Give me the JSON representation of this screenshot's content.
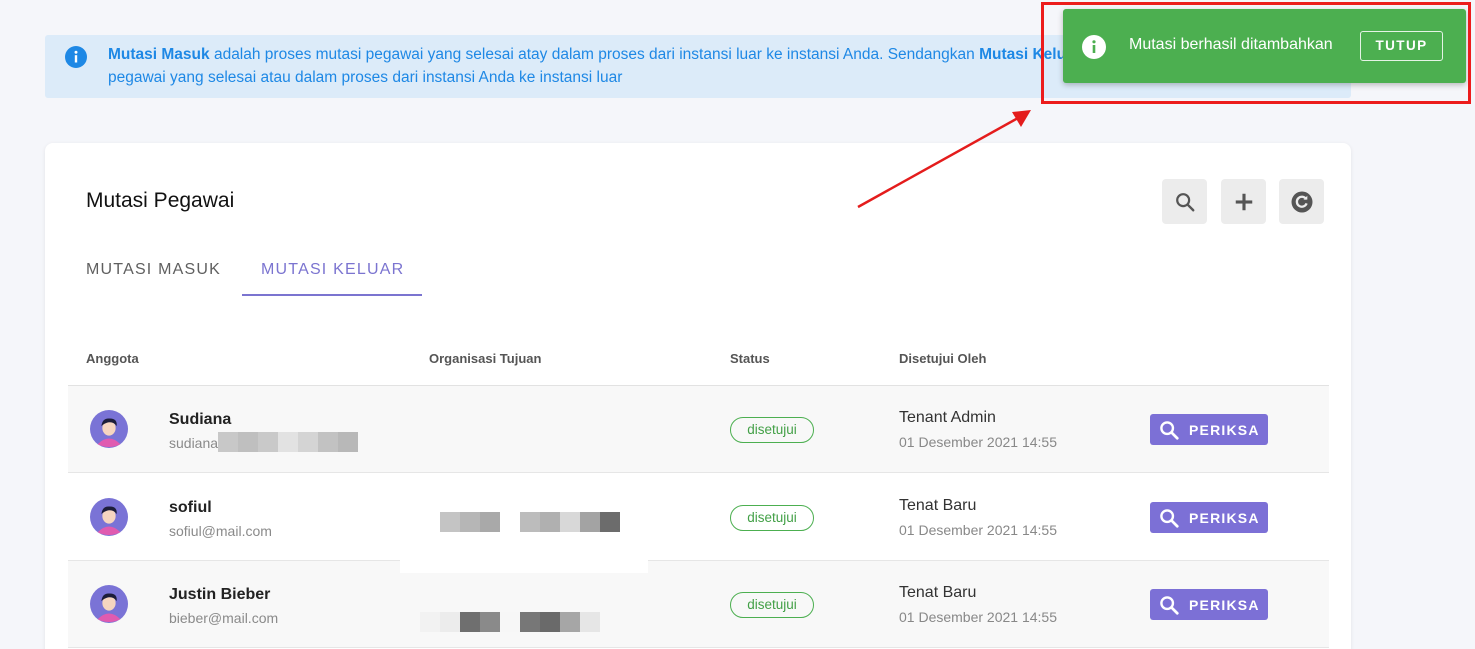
{
  "banner": {
    "term_in": "Mutasi Masuk",
    "text_in": " adalah proses mutasi pegawai yang selesai atay dalam proses dari instansi luar ke instansi Anda. Sendangkan ",
    "term_out": "Mutasi Keluar",
    "line2": "pegawai yang selesai atau dalam proses dari instansi Anda ke instansi luar"
  },
  "card": {
    "title": "Mutasi Pegawai",
    "tabs": [
      {
        "label": "MUTASI MASUK",
        "active": false
      },
      {
        "label": "MUTASI KELUAR",
        "active": true
      }
    ],
    "tools": [
      "search-icon",
      "plus-icon",
      "refresh-icon"
    ]
  },
  "table": {
    "headers": [
      "Anggota",
      "Organisasi Tujuan",
      "Status",
      "Disetujui Oleh"
    ],
    "rows": [
      {
        "name": "Sudiana",
        "email": "sudiana",
        "organization": "",
        "status": "disetujui",
        "approver": "Tenant Admin",
        "date": "01 Desember 2021 14:55",
        "action": "PERIKSA"
      },
      {
        "name": "sofiul",
        "email": "sofiul@mail.com",
        "organization": "",
        "status": "disetujui",
        "approver": "Tenat Baru",
        "date": "01 Desember 2021 14:55",
        "action": "PERIKSA"
      },
      {
        "name": "Justin Bieber",
        "email": "bieber@mail.com",
        "organization": "",
        "status": "disetujui",
        "approver": "Tenat Baru",
        "date": "01 Desember 2021 14:55",
        "action": "PERIKSA"
      }
    ]
  },
  "toast": {
    "message": "Mutasi berhasil ditambahkan",
    "close_label": "TUTUP"
  },
  "colors": {
    "accent": "#7c70d6",
    "success": "#4caf50",
    "info": "#1e88e5",
    "highlight": "#ec1c1c"
  }
}
